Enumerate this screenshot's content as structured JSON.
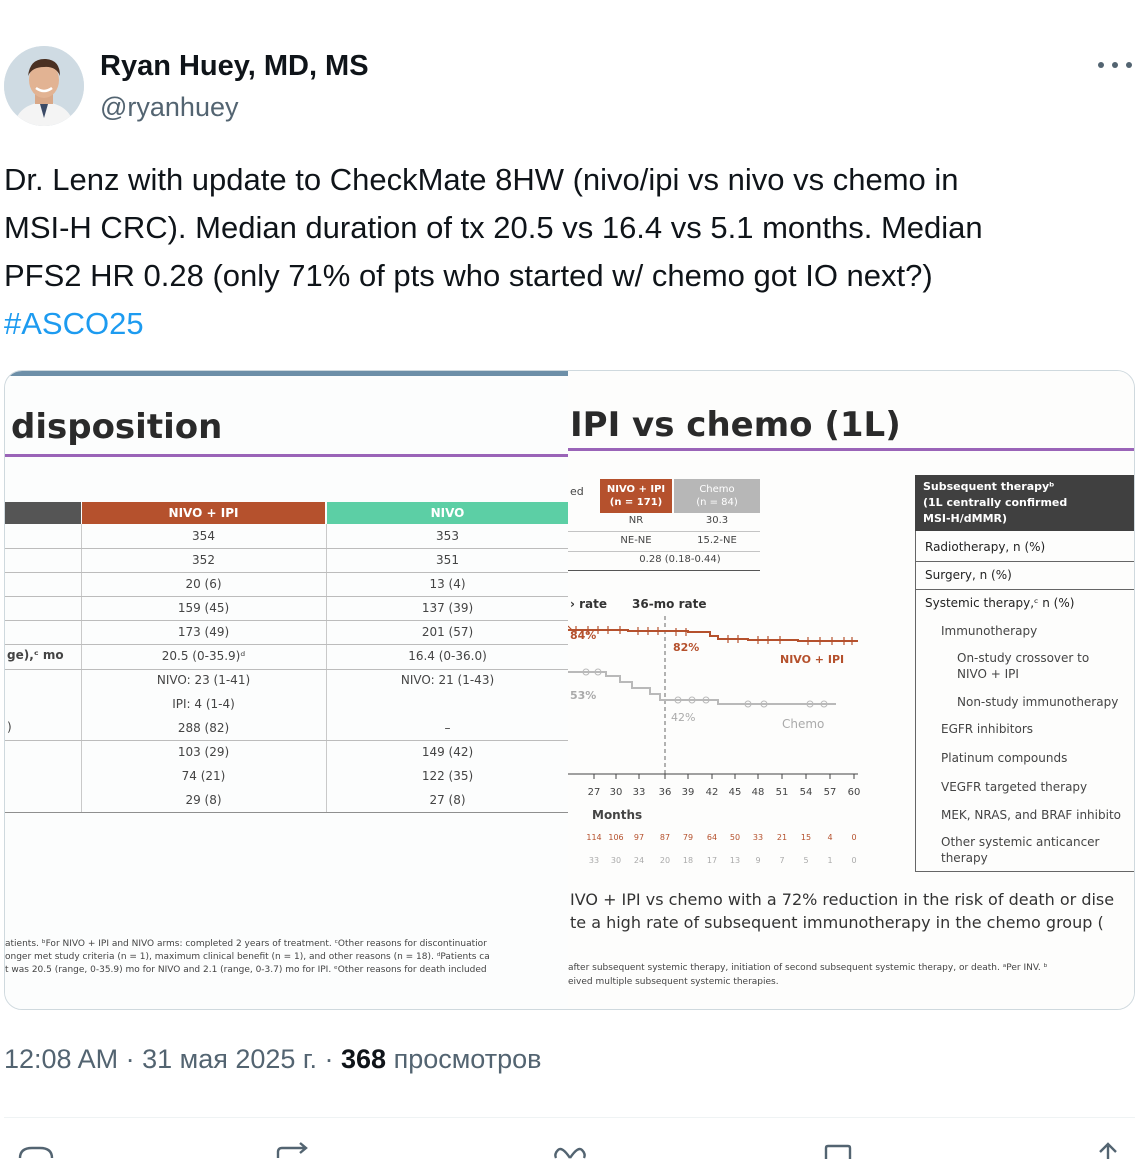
{
  "author": {
    "name": "Ryan Huey, MD, MS",
    "handle": "@ryanhuey"
  },
  "tweet": {
    "text_lines": [
      "Dr. Lenz with update to CheckMate 8HW (nivo/ipi vs nivo vs chemo in",
      "MSI-H CRC). Median duration of tx 20.5 vs 16.4 vs 5.1 months. Median",
      "PFS2 HR 0.28 (only 71% of pts who started w/ chemo got IO next?)"
    ],
    "hashtag": "#ASCO25"
  },
  "slide_left": {
    "title": "disposition",
    "col_headers": [
      "NIVO + IPI",
      "NIVO"
    ],
    "row_labels": [
      "",
      "",
      "",
      "",
      "",
      "ge),ᶜ mo",
      "",
      "",
      ")",
      "",
      "",
      ""
    ],
    "col1": [
      "354",
      "352",
      "20 (6)",
      "159 (45)",
      "173 (49)",
      "20.5 (0-35.9)ᵈ",
      "NIVO: 23 (1-41)",
      "IPI: 4 (1-4)",
      "288 (82)",
      "103 (29)",
      "74 (21)",
      "29 (8)"
    ],
    "col2": [
      "353",
      "351",
      "13 (4)",
      "137 (39)",
      "201 (57)",
      "16.4 (0-36.0)",
      "NIVO: 21 (1-43)",
      "",
      "–",
      "149 (42)",
      "122 (35)",
      "27 (8)"
    ],
    "footnotes": [
      "atients. ᵇFor NIVO + IPI and NIVO arms: completed 2 years of treatment. ᶜOther reasons for discontinuatior",
      "onger met study criteria (n = 1), maximum clinical benefit (n = 1), and other reasons (n = 18). ᵈPatients ca",
      "t was 20.5 (range, 0-35.9) mo for NIVO and 2.1 (range, 0-3.7) mo for IPI. ᵉOther reasons for death included"
    ]
  },
  "slide_right": {
    "title": "IPI vs chemo (1L)",
    "table_head_fragment": "ed",
    "col_nivo_ipi": "NIVO + IPI",
    "col_nivo_ipi_n": "(n = 171)",
    "col_chemo": "Chemo",
    "col_chemo_n": "(n = 84)",
    "rows": [
      [
        "NR",
        "30.3"
      ],
      [
        "NE-NE",
        "15.2-NE"
      ]
    ],
    "hr": "0.28 (0.18-0.44)",
    "rate_label_left": "› rate",
    "rate_label_right": "36-mo rate",
    "curve_labels": {
      "nivo_ipi_24": "84%",
      "nivo_ipi_36": "82%",
      "nivo_ipi_name": "NIVO + IPI",
      "chemo_24": "53%",
      "chemo_36": "42%",
      "chemo_name": "Chemo"
    },
    "x_ticks": [
      "27",
      "30",
      "33",
      "36",
      "39",
      "42",
      "45",
      "48",
      "51",
      "54",
      "57",
      "60"
    ],
    "x_label": "Months",
    "risk_nivo_ipi": [
      "114",
      "106",
      "97",
      "87",
      "79",
      "64",
      "50",
      "33",
      "21",
      "15",
      "4",
      "0"
    ],
    "risk_chemo": [
      "33",
      "30",
      "24",
      "20",
      "18",
      "17",
      "13",
      "9",
      "7",
      "5",
      "1",
      "0"
    ],
    "subsequent_header": [
      "Subsequent therapyᵇ",
      "(1L centrally confirmed",
      "MSI-H/dMMR)"
    ],
    "subsequent_items": [
      "Radiotherapy, n (%)",
      "Surgery, n (%)",
      "Systemic therapy,ᶜ n (%)",
      "Immunotherapy",
      "On-study crossover to",
      "NIVO + IPI",
      "Non-study immunotherapy",
      "EGFR inhibitors",
      "Platinum compounds",
      "VEGFR targeted therapy",
      "MEK, NRAS, and BRAF inhibito",
      "Other systemic anticancer",
      "therapy"
    ],
    "conclusion_lines": [
      "IVO + IPI vs chemo with a 72% reduction in the risk of death or dise",
      "te a high rate of subsequent immunotherapy in the chemo group ("
    ],
    "footnotes": [
      "after subsequent systemic therapy, initiation of second subsequent systemic therapy, or death. ᵃPer INV. ᵇ",
      "eived multiple subsequent systemic therapies."
    ]
  },
  "meta": {
    "time": "12:08 AM",
    "date": "31 мая 2025 г.",
    "views_count": "368",
    "views_label": "просмотров",
    "sep": "·"
  },
  "icons": [
    "more-icon",
    "reply-icon",
    "retweet-icon",
    "like-icon",
    "bookmark-icon",
    "share-icon"
  ],
  "colors": {
    "accent": "#1d9bf0",
    "nivo_ipi": "#b5512d",
    "nivo": "#5ccfa5",
    "chemo": "#b7b7b7",
    "purple_rule": "#9a64b8"
  }
}
